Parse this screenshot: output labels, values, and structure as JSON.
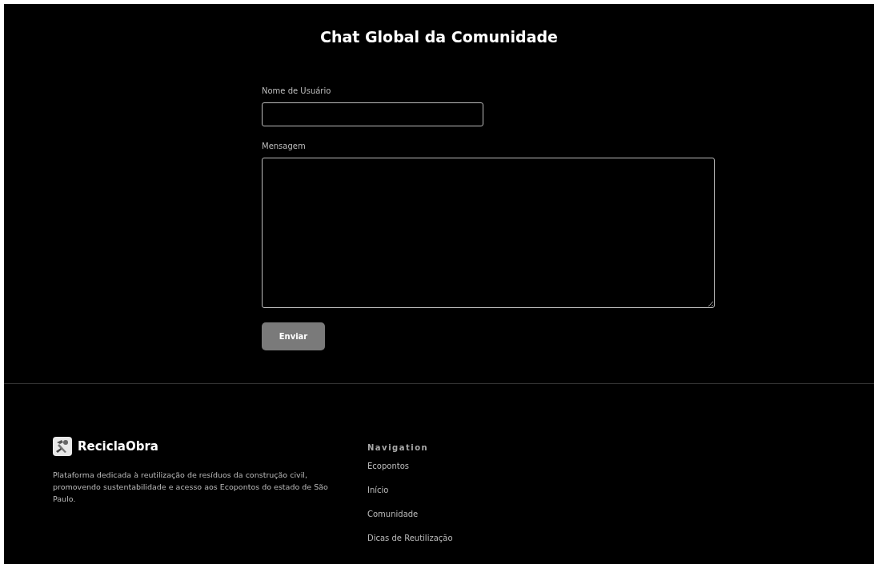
{
  "title": "Chat Global da Comunidade",
  "form": {
    "fields": [
      {
        "kind": "input",
        "label": "Nome de Usuário"
      },
      {
        "kind": "textarea",
        "label": "Mensagem"
      }
    ],
    "submit": {
      "label": "Enviar",
      "disabled": true
    }
  },
  "footer": {
    "brand": "ReciclaObra",
    "description": "Plataforma dedicada à reutilização de resíduos da construção civil, promovendo sustentabilidade e acesso aos Ecopontos do estado de São Paulo.",
    "nav_title": "Navigation",
    "nav_links": [
      "Ecopontos",
      "Início",
      "Comunidade",
      "Dicas de Reutilização"
    ]
  }
}
